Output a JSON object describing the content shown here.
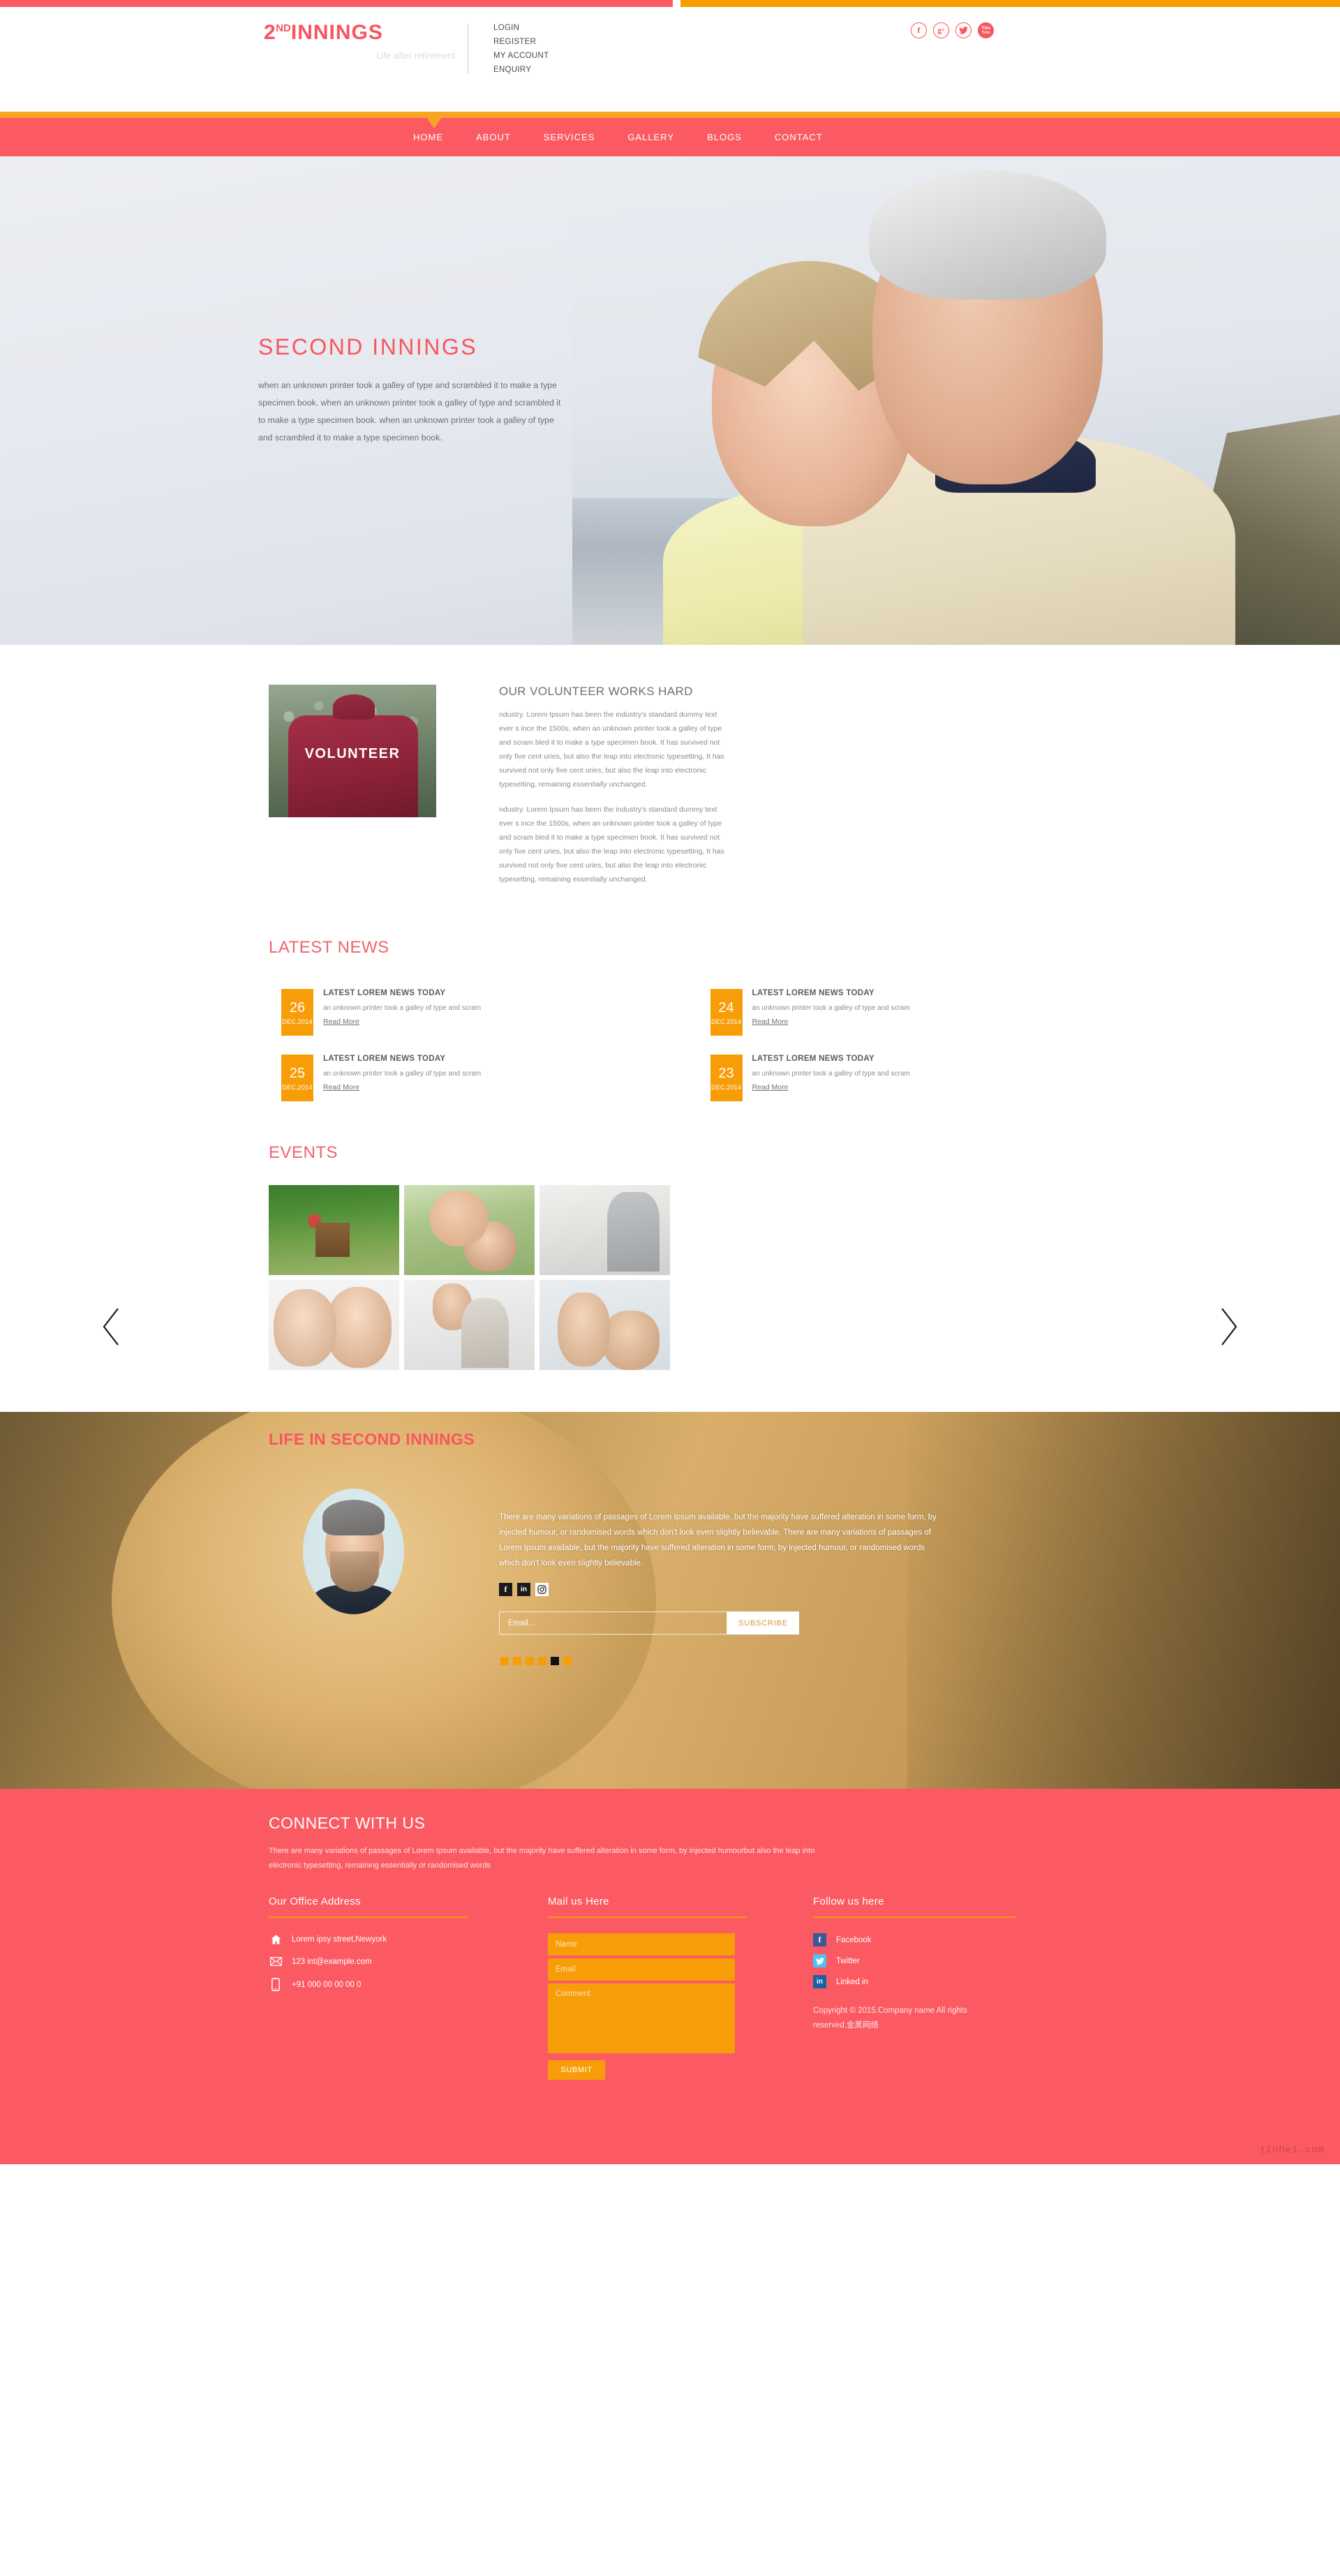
{
  "topbar": {
    "left_color": "#fb5a63",
    "right_color": "#f99d05"
  },
  "header": {
    "logo": {
      "numeral": "2",
      "superscript": "ND",
      "word": "INNINGS",
      "tagline": "Life after retirement"
    },
    "account_links": [
      {
        "label": "LOGIN"
      },
      {
        "label": "REGISTER"
      },
      {
        "label": "MY ACCOUNT"
      },
      {
        "label": "ENQUIRY"
      }
    ],
    "social": [
      {
        "name": "facebook-icon",
        "glyph": "f"
      },
      {
        "name": "google-plus-icon",
        "glyph": "g+"
      },
      {
        "name": "twitter-icon",
        "glyph": "t"
      },
      {
        "name": "youtube-icon",
        "glyph": "You Tube"
      }
    ]
  },
  "nav": {
    "items": [
      {
        "label": "HOME",
        "active": true
      },
      {
        "label": "ABOUT",
        "active": false
      },
      {
        "label": "SERVICES",
        "active": false
      },
      {
        "label": "GALLERY",
        "active": false
      },
      {
        "label": "BLOGS",
        "active": false
      },
      {
        "label": "CONTACT",
        "active": false
      }
    ]
  },
  "hero": {
    "title": "SECOND  INNINGS",
    "paragraph": "when an unknown printer took a galley of type and scrambled it to make a type specimen book. when an unknown printer took a galley of type and scrambled it to make a type specimen book. when an unknown printer took a galley of type and scrambled it to make a type specimen book."
  },
  "volunteer": {
    "image_caption": "VOLUNTEER",
    "title": "OUR VOLUNTEER WORKS HARD",
    "paragraph1": "ndustry. Lorem Ipsum has been the industry's standard dummy text ever s ince the 1500s, when an unknown printer took a galley of type and scram bled it to make a type specimen book. It has survived not only five cent uries, but also the leap into electronic typesetting, It has survived not only five cent uries, but also the leap into electronic typesetting, remaining essentially unchanged.",
    "paragraph2": "ndustry. Lorem Ipsum has been the industry's standard dummy text ever s ince the 1500s, when an unknown printer took a galley of type and scram bled it to make a type specimen book. It has survived not only five cent uries, but also the leap into electronic typesetting, It has survived not only five cent uries, but also the leap into electronic typesetting, remaining essentially unchanged."
  },
  "latest_news": {
    "title": "LATEST NEWS",
    "items": [
      {
        "day": "26",
        "month": "DEC,2014",
        "title": "LATEST LOREM NEWS TODAY",
        "excerpt": "an unknown printer took a galley of type and scram",
        "link": "Read More"
      },
      {
        "day": "24",
        "month": "DEC,2014",
        "title": "LATEST LOREM NEWS TODAY",
        "excerpt": "an unknown printer took a galley of type and scram",
        "link": "Read More"
      },
      {
        "day": "25",
        "month": "DEC,2014",
        "title": "LATEST LOREM NEWS TODAY",
        "excerpt": "an unknown printer took a galley of type and scram",
        "link": "Read More"
      },
      {
        "day": "23",
        "month": "DEC,2014",
        "title": "LATEST LOREM NEWS TODAY",
        "excerpt": "an unknown printer took a galley of type and scram",
        "link": "Read More"
      }
    ]
  },
  "events": {
    "title": "EVENTS",
    "thumbnails": [
      {
        "alt": "senior-couple-in-garden"
      },
      {
        "alt": "senior-couple-hugging"
      },
      {
        "alt": "senior-man-with-coffee-at-laptop"
      },
      {
        "alt": "two-smiling-women"
      },
      {
        "alt": "senior-couple-on-phone-with-laptop"
      },
      {
        "alt": "senior-couple-looking-at-laptop"
      }
    ],
    "prev_label": "Previous",
    "next_label": "Next"
  },
  "testimonial": {
    "title": "LIFE IN SECOND INNINGS",
    "avatar_alt": "smiling-bearded-man-portrait",
    "quote": "There are many variations of passages of Lorem Ipsum available, but the majority have suffered alteration in some form, by injected humour, or randomised words which don't look even slightly believable. There are many variations of passages of Lorem Ipsum available, but the majority have suffered alteration in some form, by injected humour, or randomised words which don't look even slightly believable.",
    "social": [
      {
        "name": "facebook-icon",
        "glyph": "f"
      },
      {
        "name": "linkedin-icon",
        "glyph": "in"
      },
      {
        "name": "instagram-icon",
        "glyph": "◙"
      }
    ],
    "subscribe": {
      "placeholder": "Email...",
      "button": "SUBSCRIBE"
    },
    "dots": [
      {
        "active": false
      },
      {
        "active": false
      },
      {
        "active": false
      },
      {
        "active": false
      },
      {
        "active": true
      },
      {
        "active": false
      }
    ]
  },
  "footer": {
    "title": "CONNECT WITH US",
    "intro": "There are many variations of passages of Lorem Ipsum available, but the majority have suffered alteration in some form, by injected humourbut also the leap into electronic typesetting, remaining essentially or randomised words",
    "address": {
      "heading": "Our Office Address",
      "items": [
        {
          "icon": "home-icon",
          "text": "Lorem ipsy street,Newyork"
        },
        {
          "icon": "envelope-icon",
          "text": "123 int@example.com"
        },
        {
          "icon": "mobile-icon",
          "text": "+91 000 00 00 00 0"
        }
      ]
    },
    "mail": {
      "heading": "Mail us Here",
      "name_placeholder": "Name",
      "email_placeholder": "Email",
      "comment_placeholder": "Comment",
      "submit_label": "SUBMIT"
    },
    "follow": {
      "heading": "Follow us here",
      "items": [
        {
          "icon": "facebook-icon",
          "glyph": "f",
          "label": "Facebook"
        },
        {
          "icon": "twitter-icon",
          "glyph": "t",
          "label": "Twitter"
        },
        {
          "icon": "linkedin-icon",
          "glyph": "in",
          "label": "Linked in"
        }
      ],
      "copyright": "Copyright © 2015.Company name All rights reserved.金黑网络"
    },
    "watermark": "jinhei.com"
  }
}
